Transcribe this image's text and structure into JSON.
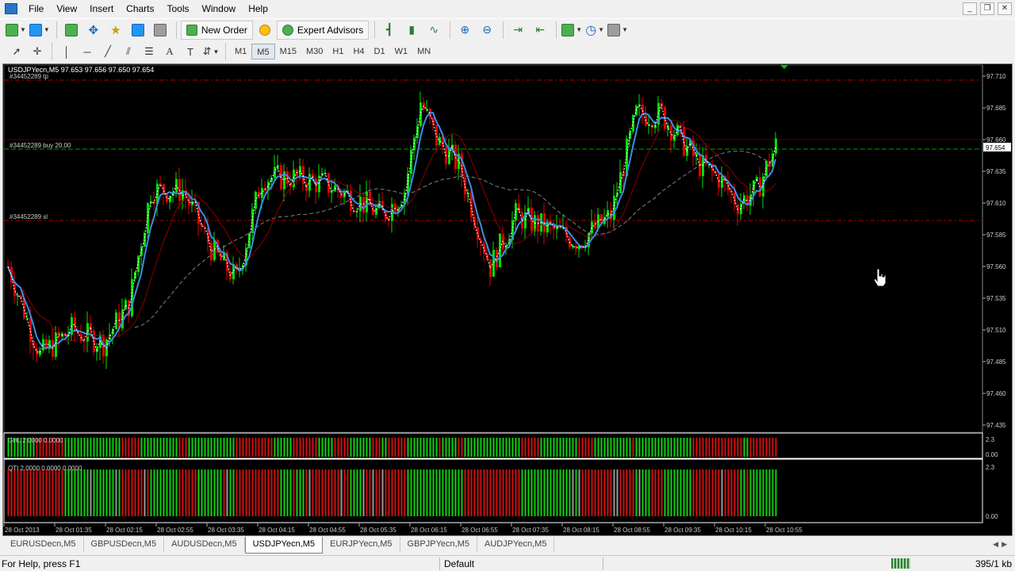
{
  "menu": [
    "File",
    "View",
    "Insert",
    "Charts",
    "Tools",
    "Window",
    "Help"
  ],
  "toolbar": {
    "new_order_label": "New Order",
    "expert_advisors_label": "Expert Advisors"
  },
  "timeframes": [
    "M1",
    "M5",
    "M15",
    "M30",
    "H1",
    "H4",
    "D1",
    "W1",
    "MN"
  ],
  "active_timeframe": "M5",
  "chart": {
    "header": "USDJPYecn,M5  97.653 97.656 97.650 97.654",
    "tp_label": "#34452289 tp",
    "order_label": "#34452289 buy 20.00",
    "sl_label": "#34452289 sl",
    "current_price": "97.654",
    "price_ticks": [
      "97.710",
      "97.685",
      "97.660",
      "97.635",
      "97.610",
      "97.585",
      "97.560",
      "97.535",
      "97.510",
      "97.485",
      "97.460",
      "97.435"
    ],
    "time_ticks": [
      "28 Oct 2013",
      "28 Oct 01:35",
      "28 Oct 02:15",
      "28 Oct 02:55",
      "28 Oct 03:35",
      "28 Oct 04:15",
      "28 Oct 04:55",
      "28 Oct 05:35",
      "28 Oct 06:15",
      "28 Oct 06:55",
      "28 Oct 07:35",
      "28 Oct 08:15",
      "28 Oct 08:55",
      "28 Oct 09:35",
      "28 Oct 10:15",
      "28 Oct 10:55"
    ],
    "ind1_label": "GHL 2.0000 0.0000",
    "ind1_scale": [
      "2.3",
      "0.00"
    ],
    "ind2_label": "QTI 2.0000 0.0000 0.0000",
    "ind2_scale": [
      "2.3",
      "0.00"
    ],
    "colors": {
      "bull": "#00e000",
      "bear": "#e00000",
      "ma_blue": "#3a8ee6",
      "ma_red": "#8b0000",
      "ma_gray": "#808080",
      "ma_white": "#ffffff"
    }
  },
  "tabs": [
    "EURUSDecn,M5",
    "GBPUSDecn,M5",
    "AUDUSDecn,M5",
    "USDJPYecn,M5",
    "EURJPYecn,M5",
    "GBPJPYecn,M5",
    "AUDJPYecn,M5"
  ],
  "active_tab": "USDJPYecn,M5",
  "status": {
    "help": "For Help, press F1",
    "profile": "Default",
    "traffic": "395/1 kb"
  }
}
